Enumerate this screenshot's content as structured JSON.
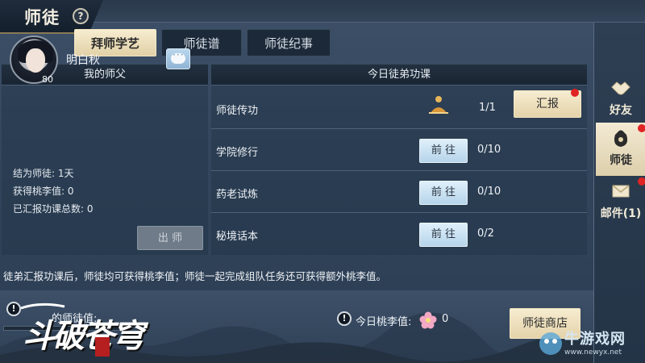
{
  "window": {
    "title": "师徒",
    "help_icon": "?"
  },
  "tabs": [
    {
      "label": "拜师学艺",
      "active": true
    },
    {
      "label": "师徒谱",
      "active": false
    },
    {
      "label": "师徒纪事",
      "active": false
    }
  ],
  "master_panel": {
    "header": "我的师父",
    "name": "明白秋",
    "level": "80",
    "chat_icon": "chat-bubble-icon",
    "stats": [
      "结为师徒: 1天",
      "获得桃李值: 0",
      "已汇报功课总数: 0"
    ],
    "leave_label": "出 师"
  },
  "lessons_panel": {
    "header": "今日徒弟功课",
    "rows": [
      {
        "name": "师徒传功",
        "progress": "1/1",
        "action": "汇报",
        "has_alert": true
      },
      {
        "name": "学院修行",
        "progress": "0/10",
        "action": "前 往"
      },
      {
        "name": "药老试炼",
        "progress": "0/10",
        "action": "前 往"
      },
      {
        "name": "秘境话本",
        "progress": "0/2",
        "action": "前 往"
      }
    ]
  },
  "info_text": "徒弟汇报功课后，师徒均可获得桃李值；师徒一起完成组队任务还可获得额外桃李值。",
  "bottom": {
    "left_label": "的师徒值:",
    "left_progress_fraction": 0.0,
    "today_label": "今日桃李值:",
    "today_value": "0",
    "flower_icon": "peach-blossom-icon",
    "shop_label": "师徒商店"
  },
  "sidebar": [
    {
      "label": "好友",
      "icon": "handshake-icon",
      "active": false,
      "alert": false
    },
    {
      "label": "师徒",
      "icon": "bag-icon",
      "active": true,
      "alert": true
    },
    {
      "label": "邮件(1)",
      "icon": "mail-icon",
      "active": false,
      "alert": true
    }
  ],
  "logo": {
    "text": "斗破苍穹",
    "stamp": "斗破之路"
  },
  "watermark": {
    "text": "牛游戏网",
    "url": "www.newyx.net"
  },
  "colors": {
    "accent_gold": "#e4d3aa",
    "alert_red": "#e02323",
    "panel_bg": "#33465d"
  }
}
